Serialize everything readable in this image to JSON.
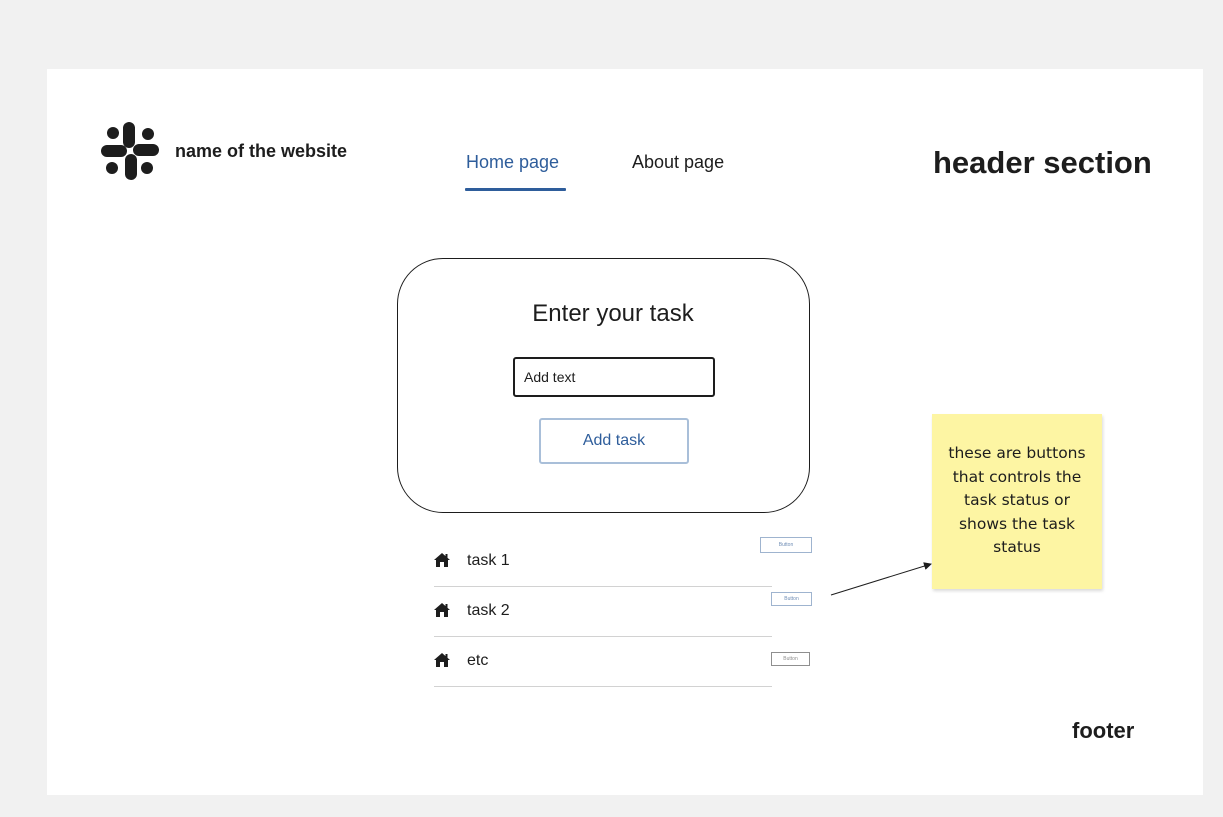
{
  "header": {
    "site_name": "name of the website",
    "nav": [
      {
        "label": "Home page",
        "active": true
      },
      {
        "label": "About page",
        "active": false
      }
    ],
    "annotation": "header section"
  },
  "task_form": {
    "title": "Enter your task",
    "input_placeholder": "Add text",
    "add_button_label": "Add task"
  },
  "tasks": [
    {
      "label": "task 1",
      "icon": "home-icon",
      "button_label": "Button"
    },
    {
      "label": "task 2",
      "icon": "home-icon",
      "button_label": "Button"
    },
    {
      "label": "etc",
      "icon": "home-icon",
      "button_label": "Button"
    }
  ],
  "sticky_note": {
    "text": "these are buttons that controls the task status or shows the task status"
  },
  "footer": {
    "annotation": "footer"
  },
  "colors": {
    "accent": "#2e5d9b",
    "sticky": "#fdf5a3",
    "text": "#1d1d1d"
  }
}
